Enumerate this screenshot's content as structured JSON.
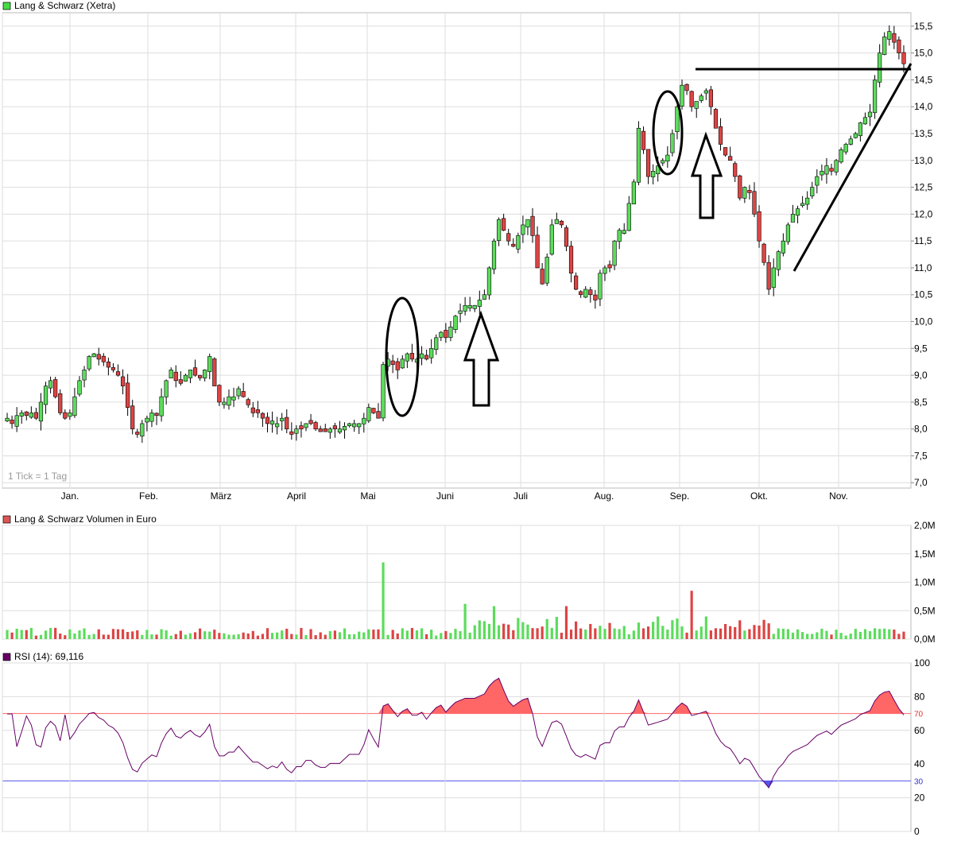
{
  "price_panel": {
    "legend_label": "Lang & Schwarz (Xetra)",
    "legend_color": "#44dd44",
    "tick_note": "1 Tick = 1 Tag"
  },
  "volume_panel": {
    "legend_label": "Lang & Schwarz Volumen in Euro",
    "legend_color": "#dd5555"
  },
  "rsi_panel": {
    "legend_label": "RSI (14): 69,116",
    "legend_color": "#660066"
  },
  "colors": {
    "up": "#5cdc5c",
    "down": "#dd4444",
    "grid": "#dddddd",
    "rsi_line": "#660066",
    "rsi_over": "#ff6666",
    "rsi_under": "#5555ee"
  },
  "chart_data": [
    {
      "type": "candlestick",
      "y_ticks": [
        "7,0",
        "7,5",
        "8,0",
        "8,5",
        "9,0",
        "9,5",
        "10,0",
        "10,5",
        "11,0",
        "11,5",
        "12,0",
        "12,5",
        "13,0",
        "13,5",
        "14,0",
        "14,5",
        "15,0",
        "15,5"
      ],
      "ylim": [
        6.9,
        15.75
      ],
      "x_ticks": [
        "Jan.",
        "Feb.",
        "März",
        "April",
        "Mai",
        "Juni",
        "Juli",
        "Aug.",
        "Sep.",
        "Okt.",
        "Nov."
      ],
      "close_series": [
        8.2,
        8.1,
        8.25,
        8.3,
        8.25,
        8.3,
        8.2,
        8.5,
        8.8,
        8.9,
        8.6,
        8.3,
        8.2,
        8.3,
        8.6,
        8.9,
        9.1,
        9.35,
        9.4,
        9.3,
        9.25,
        9.15,
        9.1,
        9.0,
        8.8,
        8.4,
        8.0,
        7.9,
        8.1,
        8.2,
        8.3,
        8.25,
        8.6,
        8.9,
        9.1,
        8.9,
        8.85,
        9.0,
        9.1,
        9.0,
        8.95,
        9.1,
        9.35,
        8.8,
        8.5,
        8.5,
        8.6,
        8.6,
        8.75,
        8.6,
        8.45,
        8.3,
        8.3,
        8.2,
        8.1,
        8.15,
        8.1,
        8.2,
        8.0,
        7.9,
        8.0,
        8.0,
        8.1,
        8.1,
        8.0,
        7.95,
        7.95,
        8.0,
        8.0,
        8.0,
        8.05,
        8.1,
        8.1,
        8.1,
        8.2,
        8.4,
        8.3,
        8.2,
        9.2,
        9.3,
        9.2,
        9.1,
        9.3,
        9.4,
        9.3,
        9.3,
        9.4,
        9.3,
        9.5,
        9.7,
        9.8,
        9.7,
        9.9,
        10.1,
        10.2,
        10.3,
        10.3,
        10.3,
        10.4,
        10.5,
        11.0,
        11.5,
        11.9,
        11.7,
        11.5,
        11.4,
        11.6,
        11.8,
        11.9,
        11.6,
        11.0,
        10.7,
        11.2,
        11.8,
        11.9,
        11.8,
        11.4,
        10.9,
        10.6,
        10.5,
        10.6,
        10.5,
        10.4,
        10.9,
        11.0,
        11.0,
        11.5,
        11.7,
        11.7,
        12.2,
        12.6,
        13.6,
        13.2,
        12.7,
        12.8,
        12.9,
        13.0,
        13.1,
        13.5,
        14.0,
        14.4,
        14.3,
        14.0,
        14.1,
        14.2,
        14.3,
        14.0,
        13.6,
        13.3,
        13.1,
        13.0,
        12.7,
        12.3,
        12.5,
        12.4,
        12.0,
        11.5,
        11.1,
        10.6,
        11.0,
        11.3,
        11.5,
        11.8,
        12.0,
        12.1,
        12.2,
        12.3,
        12.5,
        12.7,
        12.8,
        12.9,
        12.8,
        13.0,
        13.2,
        13.3,
        13.4,
        13.5,
        13.7,
        13.8,
        13.9,
        14.5,
        15.0,
        15.3,
        15.4,
        15.2,
        15.0,
        14.8
      ]
    },
    {
      "type": "bar",
      "title": "Lang & Schwarz Volumen in Euro",
      "y_ticks": [
        "0,0M",
        "0,5M",
        "1,0M",
        "1,5M",
        "2,0M"
      ],
      "ylim": [
        0,
        2.0
      ],
      "unit": "M"
    },
    {
      "type": "line",
      "title": "RSI (14)",
      "last_value": 69.116,
      "y_ticks": [
        "0",
        "20",
        "30",
        "40",
        "60",
        "70",
        "80",
        "100"
      ],
      "ylim": [
        0,
        100
      ],
      "overbought": 70,
      "oversold": 30
    }
  ],
  "annotations": [
    "ellipse",
    "ellipse",
    "ellipse",
    "up-arrow",
    "up-arrow",
    "horizontal-resistance-line",
    "rising-trend-line"
  ]
}
